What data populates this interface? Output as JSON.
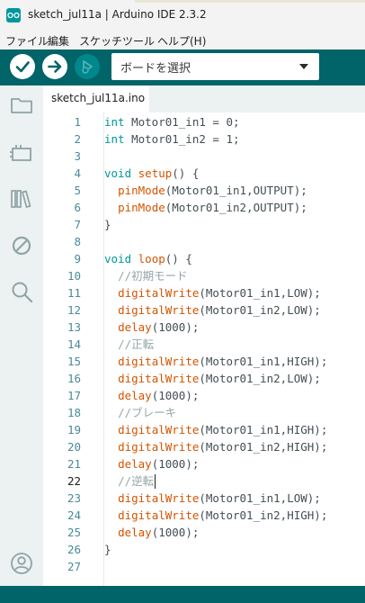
{
  "window": {
    "title": "sketch_jul11a | Arduino IDE 2.3.2"
  },
  "menu": [
    "ファイル",
    "編集",
    "スケッチ",
    "ツール",
    "ヘルプ(H)"
  ],
  "toolbar": {
    "verify_icon": "check-icon",
    "upload_icon": "arrow-right-icon",
    "debug_icon": "debug-icon",
    "board_select": "ボードを選択"
  },
  "sidebar": {
    "icons": [
      "folder-icon",
      "board-manager-icon",
      "library-icon",
      "no-debug-icon",
      "search-icon",
      "account-icon"
    ]
  },
  "tabs": [
    {
      "label": "sketch_jul11a.ino"
    }
  ],
  "editor": {
    "active_line": 22,
    "lines": [
      {
        "n": "1",
        "code": "int Motor01_in1 = 0;"
      },
      {
        "n": "2",
        "code": "int Motor01_in2 = 1;"
      },
      {
        "n": "3",
        "code": ""
      },
      {
        "n": "4",
        "code": "void setup() {"
      },
      {
        "n": "5",
        "code": "  pinMode(Motor01_in1,OUTPUT);"
      },
      {
        "n": "6",
        "code": "  pinMode(Motor01_in2,OUTPUT);"
      },
      {
        "n": "7",
        "code": "}"
      },
      {
        "n": "8",
        "code": ""
      },
      {
        "n": "9",
        "code": "void loop() {"
      },
      {
        "n": "10",
        "code": "  //初期モード"
      },
      {
        "n": "11",
        "code": "  digitalWrite(Motor01_in1,LOW);"
      },
      {
        "n": "12",
        "code": "  digitalWrite(Motor01_in2,LOW);"
      },
      {
        "n": "13",
        "code": "  delay(1000);"
      },
      {
        "n": "14",
        "code": "  //正転"
      },
      {
        "n": "15",
        "code": "  digitalWrite(Motor01_in1,HIGH);"
      },
      {
        "n": "16",
        "code": "  digitalWrite(Motor01_in2,LOW);"
      },
      {
        "n": "17",
        "code": "  delay(1000);"
      },
      {
        "n": "18",
        "code": "  //ブレーキ"
      },
      {
        "n": "19",
        "code": "  digitalWrite(Motor01_in1,HIGH);"
      },
      {
        "n": "20",
        "code": "  digitalWrite(Motor01_in2,HIGH);"
      },
      {
        "n": "21",
        "code": "  delay(1000);"
      },
      {
        "n": "22",
        "code": "  //逆転"
      },
      {
        "n": "23",
        "code": "  digitalWrite(Motor01_in1,LOW);"
      },
      {
        "n": "24",
        "code": "  digitalWrite(Motor01_in2,HIGH);"
      },
      {
        "n": "25",
        "code": "  delay(1000);"
      },
      {
        "n": "26",
        "code": "}"
      },
      {
        "n": "27",
        "code": ""
      }
    ]
  },
  "colors": {
    "toolbar": "#006468",
    "sidebar": "#ecf1f1",
    "keyword_type": "#00979d",
    "keyword_function": "#d35400",
    "comment": "#95a5a6",
    "line_number": "#4a8a9a"
  }
}
